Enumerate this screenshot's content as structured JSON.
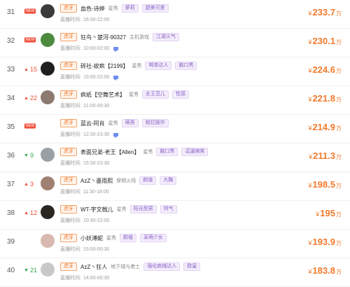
{
  "rows": [
    {
      "rank": "31",
      "change_type": "new",
      "change": "NEW",
      "platform": "虎牙",
      "name": "血色-诗婷",
      "category": "星秀",
      "tags": [
        "萝莉",
        "甜美可爱"
      ],
      "time_label": "直播时间:",
      "time": "16:30-22:00",
      "live": false,
      "currency": "¥",
      "amount": "233.7",
      "unit": "万",
      "avatar_color": "#3a3a3a"
    },
    {
      "rank": "32",
      "change_type": "new",
      "change": "NEW",
      "platform": "虎牙",
      "name": "狂鸟丶楚河-90327",
      "category": "主机游戏",
      "tags": [
        "江湖义气"
      ],
      "time_label": "直播时间:",
      "time": "10:00-02:00",
      "live": true,
      "currency": "¥",
      "amount": "230.1",
      "unit": "万",
      "avatar_color": "#4c8a3e"
    },
    {
      "rank": "33",
      "change_type": "up",
      "change": "15",
      "platform": "虎牙",
      "name": "砖社-故疯【2199】",
      "category": "星秀",
      "tags": [
        "喝茶达人",
        "脑口秀"
      ],
      "time_label": "直播时间:",
      "time": "15:00-22:00",
      "live": true,
      "currency": "¥",
      "amount": "224.6",
      "unit": "万",
      "avatar_color": "#1f1f1f"
    },
    {
      "rank": "34",
      "change_type": "up",
      "change": "22",
      "platform": "虎牙",
      "name": "疯纸【空舞艺术】",
      "category": "星秀",
      "tags": [
        "女王范儿",
        "性感"
      ],
      "time_label": "直播时间:",
      "time": "21:00-00:30",
      "live": false,
      "currency": "¥",
      "amount": "221.8",
      "unit": "万",
      "avatar_color": "#8c7a70"
    },
    {
      "rank": "35",
      "change_type": "new",
      "change": "NEW",
      "platform": "虎牙",
      "name": "蓝云-阿肖",
      "category": "星秀",
      "tags": [
        "萌男",
        "帕拉操作"
      ],
      "time_label": "直播时间:",
      "time": "12:30-23:30",
      "live": true,
      "currency": "¥",
      "amount": "214.9",
      "unit": "万",
      "avatar_color": "#ffffff"
    },
    {
      "rank": "36",
      "change_type": "down",
      "change": "9",
      "platform": "虎牙",
      "name": "表面兄弟-老王【Allen】",
      "category": "星秀",
      "tags": [
        "脑口秀",
        "逗逼搞笑"
      ],
      "time_label": "直播时间:",
      "time": "15:30-23:30",
      "live": false,
      "currency": "¥",
      "amount": "211.3",
      "unit": "万",
      "avatar_color": "#9aa0a6"
    },
    {
      "rank": "37",
      "change_type": "up",
      "change": "3",
      "platform": "虎牙",
      "name": "AzZ丶墨雨熙",
      "category": "穿越火线",
      "tags": [
        "颜值",
        "大胸"
      ],
      "time_label": "直播时间:",
      "time": "11:30-18:00",
      "live": false,
      "currency": "¥",
      "amount": "198.5",
      "unit": "万",
      "avatar_color": "#a08070"
    },
    {
      "rank": "38",
      "change_type": "up",
      "change": "12",
      "platform": "虎牙",
      "name": "WT-宇文戟儿",
      "category": "星秀",
      "tags": [
        "阳光型男",
        "帅气"
      ],
      "time_label": "直播时间:",
      "time": "10:30-22:00",
      "live": false,
      "currency": "¥",
      "amount": "195",
      "unit": "万",
      "avatar_color": "#2a2622"
    },
    {
      "rank": "39",
      "change_type": "none",
      "change": "",
      "platform": "虎牙",
      "name": "小妖溥妮",
      "category": "星秀",
      "tags": [
        "颜值",
        "呆萌少女"
      ],
      "time_label": "直播时间:",
      "time": "15:00-00:30",
      "live": false,
      "currency": "¥",
      "amount": "193.9",
      "unit": "万",
      "avatar_color": "#d9b8b0"
    },
    {
      "rank": "40",
      "change_type": "down",
      "change": "21",
      "platform": "虎牙",
      "name": "AzZ丶狂人",
      "category": "地下城与勇士",
      "tags": [
        "强化疯械达人",
        "欧皇"
      ],
      "time_label": "直播时间:",
      "time": "14:00-00:30",
      "live": false,
      "currency": "¥",
      "amount": "183.8",
      "unit": "万",
      "avatar_color": "#c8c8c8"
    }
  ]
}
